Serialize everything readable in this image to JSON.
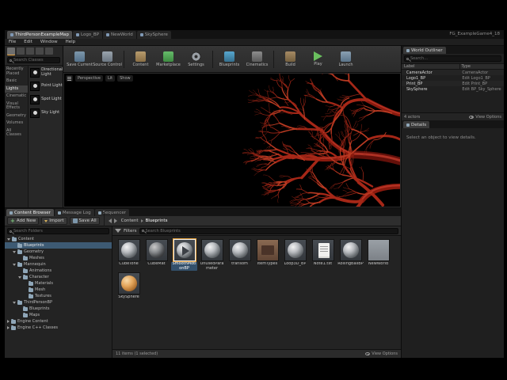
{
  "window": {
    "project_name": "FG_ExampleGame4_18",
    "menu": [
      "File",
      "Edit",
      "Window",
      "Help"
    ],
    "tabs": [
      {
        "label": "ThirdPersonExampleMap",
        "active": true
      },
      {
        "label": "Logo_BP",
        "active": false
      },
      {
        "label": "NewWorld",
        "active": false
      },
      {
        "label": "SkySphere",
        "active": false
      }
    ]
  },
  "modes_panel": {
    "mode_icons": [
      "place-mode-icon",
      "paint-mode-icon",
      "landscape-mode-icon",
      "foliage-mode-icon",
      "geometry-mode-icon"
    ],
    "search_placeholder": "Search Classes",
    "categories": [
      "Recently Placed",
      "Basic",
      "Lights",
      "Cinematic",
      "Visual Effects",
      "Geometry",
      "Volumes",
      "All Classes"
    ],
    "selected_category": "Lights",
    "items": [
      "Directional Light",
      "Point Light",
      "Spot Light",
      "Sky Light"
    ]
  },
  "toolbar": {
    "buttons": [
      {
        "label": "Save Current",
        "icon": "save-icon"
      },
      {
        "label": "Source Control",
        "icon": "source-control-icon"
      },
      {
        "label": "Content",
        "icon": "content-icon"
      },
      {
        "label": "Marketplace",
        "icon": "marketplace-icon"
      },
      {
        "label": "Settings",
        "icon": "settings-icon"
      },
      {
        "label": "Blueprints",
        "icon": "blueprints-icon"
      },
      {
        "label": "Cinematics",
        "icon": "cinematics-icon"
      },
      {
        "label": "Build",
        "icon": "build-icon"
      },
      {
        "label": "Play",
        "icon": "play-icon"
      },
      {
        "label": "Launch",
        "icon": "launch-icon"
      }
    ]
  },
  "viewport": {
    "perspective": "Perspective",
    "lit": "Lit",
    "show": "Show"
  },
  "outliner": {
    "tab": "World Outliner",
    "search_placeholder": "Search...",
    "columns": [
      "Label",
      "Type"
    ],
    "rows": [
      {
        "label": "CameraActor",
        "type": "CameraActor"
      },
      {
        "label": "Logo1_BP",
        "type": "Edit Logo1_BP"
      },
      {
        "label": "Print_BP",
        "type": "Edit Print_BP"
      },
      {
        "label": "SkySphere",
        "type": "Edit BP_Sky_Sphere"
      }
    ],
    "footer_count": "4 actors",
    "view_options": "View Options"
  },
  "details": {
    "tab": "Details",
    "empty_message": "Select an object to view details."
  },
  "content_browser": {
    "tabs": [
      {
        "label": "Content Browser",
        "active": true
      },
      {
        "label": "Message Log",
        "active": false
      },
      {
        "label": "Sequencer",
        "active": false
      }
    ],
    "add_new": "Add New",
    "import": "Import",
    "save_all": "Save All",
    "breadcrumb": [
      "Content",
      "Blueprints"
    ],
    "folders_search_placeholder": "Search Folders",
    "filters_label": "Filters",
    "assets_search_placeholder": "Search Blueprints",
    "tree": [
      {
        "label": "Content",
        "depth": 0,
        "arrow": "down",
        "selected": false
      },
      {
        "label": "Blueprints",
        "depth": 1,
        "arrow": "none",
        "selected": true
      },
      {
        "label": "Geometry",
        "depth": 1,
        "arrow": "down",
        "selected": false
      },
      {
        "label": "Meshes",
        "depth": 2,
        "arrow": "none",
        "selected": false
      },
      {
        "label": "Mannequin",
        "depth": 1,
        "arrow": "down",
        "selected": false
      },
      {
        "label": "Animations",
        "depth": 2,
        "arrow": "none",
        "selected": false
      },
      {
        "label": "Character",
        "depth": 2,
        "arrow": "down",
        "selected": false
      },
      {
        "label": "Materials",
        "depth": 3,
        "arrow": "none",
        "selected": false
      },
      {
        "label": "Mesh",
        "depth": 3,
        "arrow": "none",
        "selected": false
      },
      {
        "label": "Textures",
        "depth": 3,
        "arrow": "none",
        "selected": false
      },
      {
        "label": "ThirdPersonBP",
        "depth": 1,
        "arrow": "down",
        "selected": false
      },
      {
        "label": "Blueprints",
        "depth": 2,
        "arrow": "none",
        "selected": false
      },
      {
        "label": "Maps",
        "depth": 2,
        "arrow": "none",
        "selected": false
      },
      {
        "label": "Engine Content",
        "depth": 0,
        "arrow": "rightA",
        "selected": false
      },
      {
        "label": "Engine C++ Classes",
        "depth": 0,
        "arrow": "rightA",
        "selected": false
      }
    ],
    "assets": [
      {
        "name": "CubeTone",
        "kind": "sphere",
        "selected": false
      },
      {
        "name": "CubeMat",
        "kind": "sphere-dark",
        "selected": false
      },
      {
        "name": "SmoothMotionBP",
        "kind": "media",
        "selected": true
      },
      {
        "name": "UnusedParameter",
        "kind": "sphere",
        "selected": false
      },
      {
        "name": "transom",
        "kind": "sphere",
        "selected": false
      },
      {
        "name": "ItemTypes",
        "kind": "enum",
        "selected": false
      },
      {
        "name": "Loop3D_BP",
        "kind": "sphere",
        "selected": false
      },
      {
        "name": "Note1.txt",
        "kind": "text",
        "selected": false
      },
      {
        "name": "RollingBallBP",
        "kind": "sphere",
        "selected": false
      },
      {
        "name": "NewWorld",
        "kind": "level",
        "selected": false
      },
      {
        "name": "SkySphere",
        "kind": "sphere-orange",
        "selected": false
      }
    ],
    "footer": "11 items (1 selected)",
    "view_options": "View Options"
  },
  "colors": {
    "accent_orange": "#e8a33d",
    "play_green": "#6abf5e",
    "marketplace_green": "#4caf50",
    "selection_blue": "#3d5a73",
    "vessel_red": "#a52717"
  }
}
